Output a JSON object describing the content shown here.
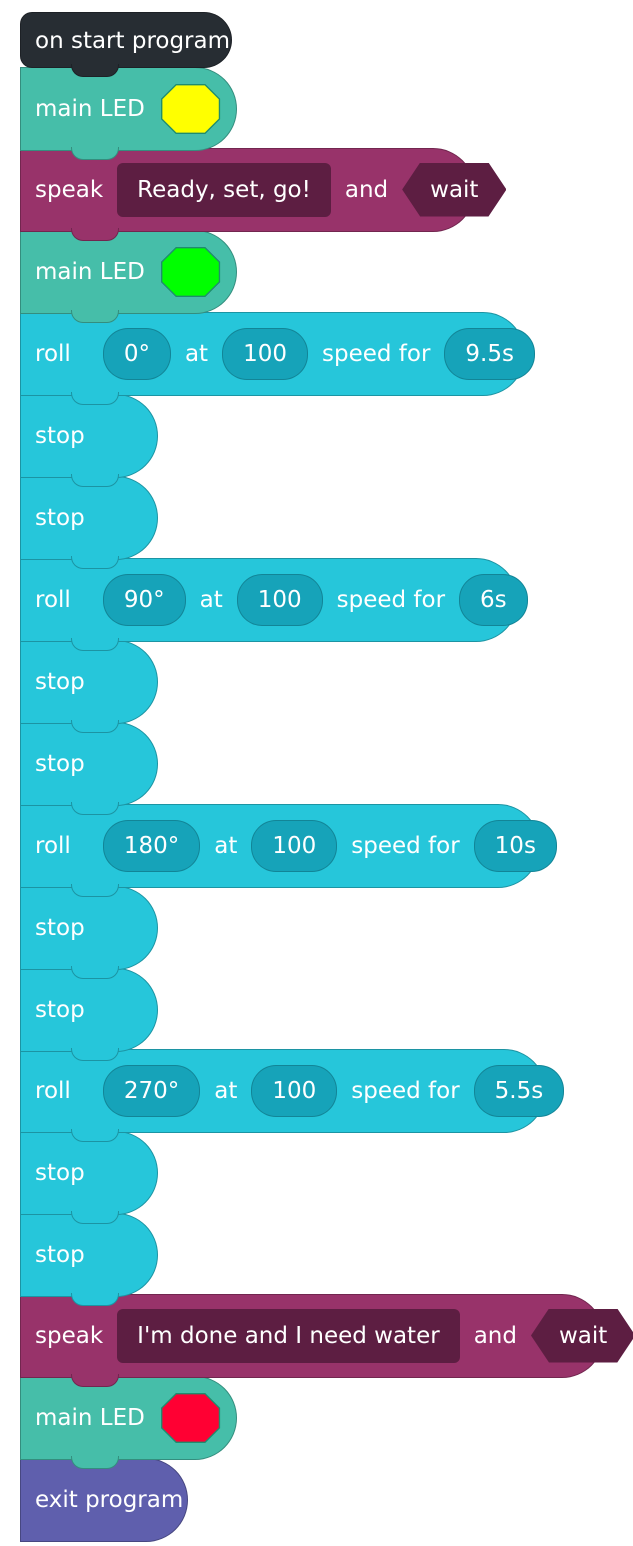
{
  "colors": {
    "hat": "#272d33",
    "led_block": "#46bea9",
    "speak_block": "#98336a",
    "motion_block": "#26c6da",
    "motion_pill": "#16a3b9",
    "speak_field": "#5d1e42",
    "exit_block": "#5f5fad"
  },
  "blocks": [
    {
      "type": "hat",
      "label": "on start program"
    },
    {
      "type": "led",
      "label": "main LED",
      "color": "#ffff00",
      "color_name": "yellow"
    },
    {
      "type": "speak",
      "label": "speak",
      "text": "Ready, set, go!",
      "and": "and",
      "mode": "wait"
    },
    {
      "type": "led",
      "label": "main LED",
      "color": "#00ff00",
      "color_name": "green"
    },
    {
      "type": "roll",
      "label": "roll",
      "heading": "0°",
      "at": "at",
      "speed": "100",
      "speed_for": "speed for",
      "duration": "9.5s"
    },
    {
      "type": "stop",
      "label": "stop"
    },
    {
      "type": "stop",
      "label": "stop"
    },
    {
      "type": "roll",
      "label": "roll",
      "heading": "90°",
      "at": "at",
      "speed": "100",
      "speed_for": "speed for",
      "duration": "6s"
    },
    {
      "type": "stop",
      "label": "stop"
    },
    {
      "type": "stop",
      "label": "stop"
    },
    {
      "type": "roll",
      "label": "roll",
      "heading": "180°",
      "at": "at",
      "speed": "100",
      "speed_for": "speed for",
      "duration": "10s"
    },
    {
      "type": "stop",
      "label": "stop"
    },
    {
      "type": "stop",
      "label": "stop"
    },
    {
      "type": "roll",
      "label": "roll",
      "heading": "270°",
      "at": "at",
      "speed": "100",
      "speed_for": "speed for",
      "duration": "5.5s"
    },
    {
      "type": "stop",
      "label": "stop"
    },
    {
      "type": "stop",
      "label": "stop"
    },
    {
      "type": "speak",
      "label": "speak",
      "text": "I'm done and I need water",
      "and": "and",
      "mode": "wait"
    },
    {
      "type": "led",
      "label": "main LED",
      "color": "#ff0033",
      "color_name": "red"
    },
    {
      "type": "exit",
      "label": "exit program"
    }
  ]
}
